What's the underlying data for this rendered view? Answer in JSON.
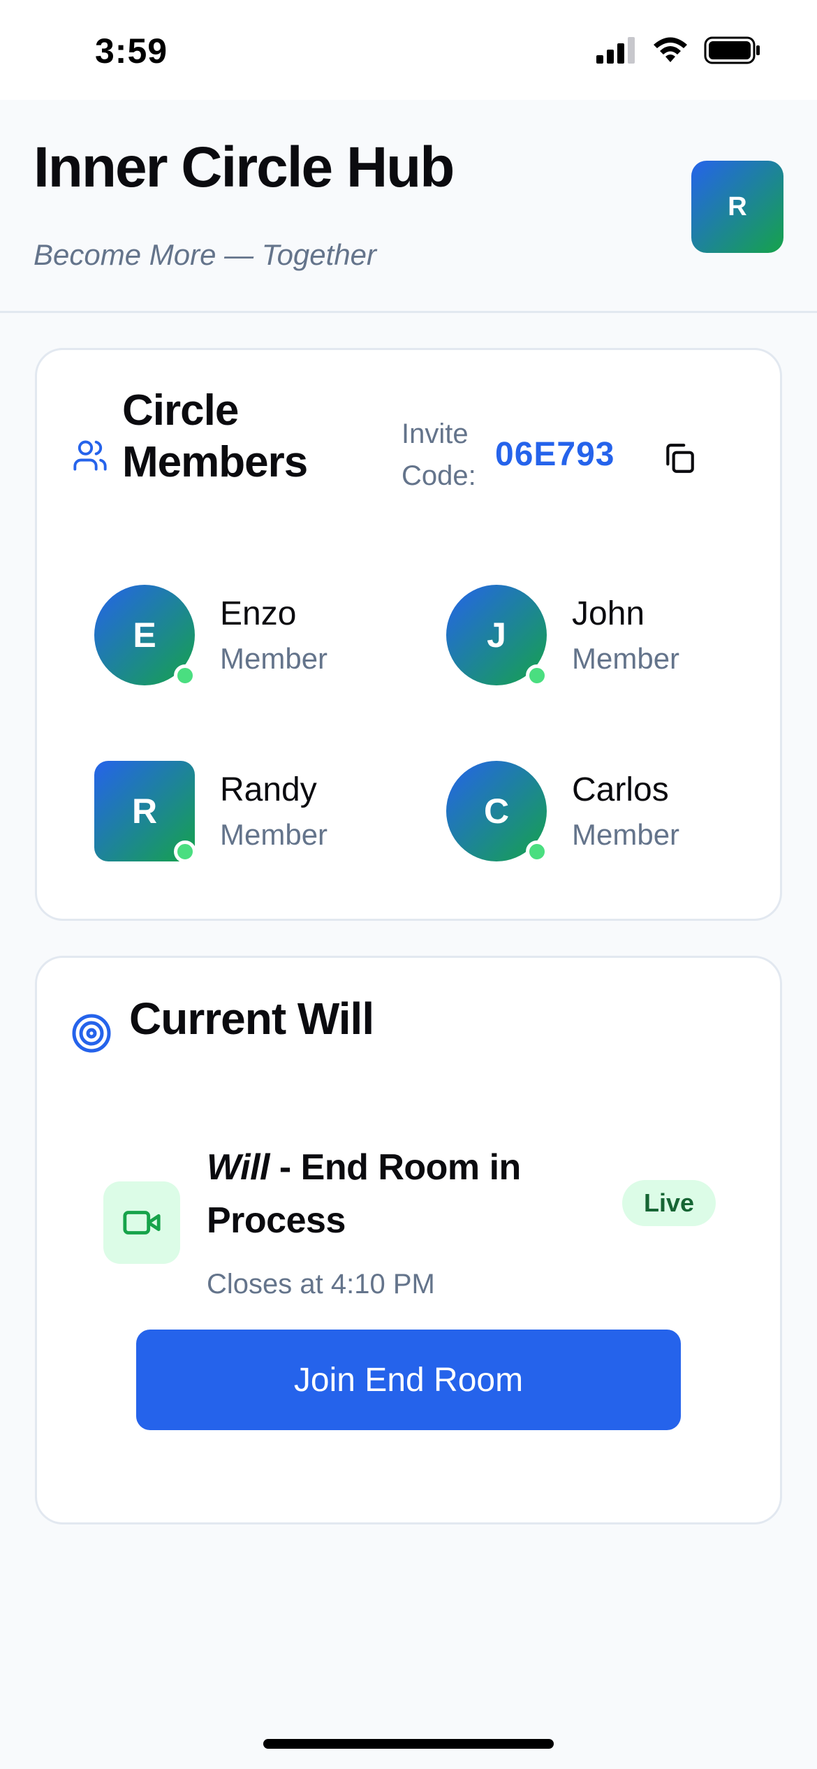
{
  "status_bar": {
    "time": "3:59",
    "icons": [
      "cellular-signal-icon",
      "wifi-icon",
      "battery-icon"
    ]
  },
  "header": {
    "title": "Inner Circle Hub",
    "tagline": "Become More — Together",
    "profile_initial": "R"
  },
  "members_card": {
    "icon": "users-icon",
    "title": "Circle Members",
    "invite_label": "Invite Code:",
    "invite_code": "06E793",
    "copy_icon": "copy-icon",
    "members": [
      {
        "initial": "E",
        "name": "Enzo",
        "role": "Member",
        "online": true
      },
      {
        "initial": "J",
        "name": "John",
        "role": "Member",
        "online": true
      },
      {
        "initial": "R",
        "name": "Randy",
        "role": "Member",
        "online": true
      },
      {
        "initial": "C",
        "name": "Carlos",
        "role": "Member",
        "online": true
      }
    ]
  },
  "will_card": {
    "icon": "target-icon",
    "title": "Current Will",
    "status_emphasis": "Will",
    "status_rest": " - End Room in Process",
    "badge": "Live",
    "closes": "Closes at 4:10 PM",
    "join_label": "Join End Room",
    "video_icon": "video-camera-icon"
  },
  "colors": {
    "accent_blue": "#2563eb",
    "accent_green": "#16a34a",
    "online_green": "#4ade80",
    "muted_text": "#64748b",
    "badge_bg": "#dcfce7"
  }
}
